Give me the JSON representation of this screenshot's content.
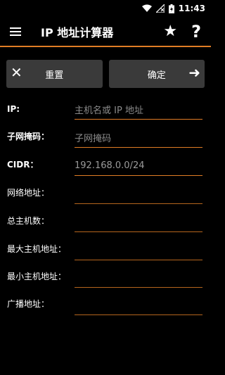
{
  "status_bar": {
    "time": "11:43",
    "icons": [
      "wifi-icon",
      "no-signal-icon",
      "battery-charging-icon"
    ]
  },
  "app_bar": {
    "title": "IP 地址计算器",
    "icons": [
      "menu-icon",
      "star-icon",
      "help-icon"
    ]
  },
  "colors": {
    "accent": "#e07c25",
    "button_bg": "#3a3a3a",
    "background": "#000000"
  },
  "buttons": {
    "reset_label": "重置",
    "confirm_label": "确定"
  },
  "fields": {
    "ip": {
      "label": "IP:",
      "placeholder": "主机名或 IP 地址",
      "value": ""
    },
    "subnet": {
      "label": "子网掩码：",
      "placeholder": "子网掩码",
      "value": ""
    },
    "cidr": {
      "label": "CIDR：",
      "placeholder": "",
      "value": "192.168.0.0/24"
    },
    "network": {
      "label": "网络地址：",
      "value": ""
    },
    "total_hosts": {
      "label": "总主机数：",
      "value": ""
    },
    "max_host": {
      "label": "最大主机地址：",
      "value": ""
    },
    "min_host": {
      "label": "最小主机地址：",
      "value": ""
    },
    "broadcast": {
      "label": "广播地址：",
      "value": ""
    }
  }
}
